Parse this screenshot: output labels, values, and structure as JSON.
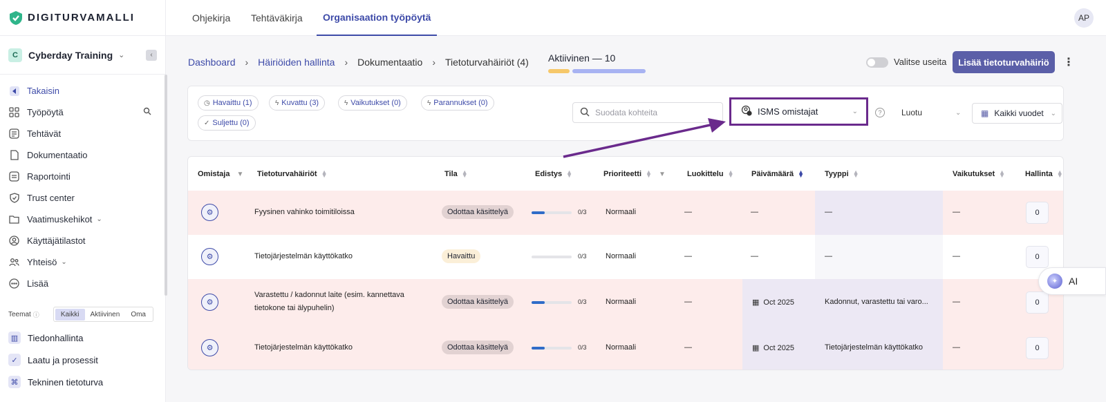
{
  "brand": {
    "name": "DIGITURVAMALLI"
  },
  "org": {
    "badge": "C",
    "name": "Cyberday Training"
  },
  "top_tabs": [
    {
      "label": "Ohjekirja"
    },
    {
      "label": "Tehtäväkirja"
    },
    {
      "label": "Organisaation työpöytä",
      "active": true
    }
  ],
  "avatar": "AP",
  "sidebar": {
    "items": [
      {
        "label": "Takaisin",
        "icon": "back-icon"
      },
      {
        "label": "Työpöytä",
        "icon": "dashboard-icon"
      },
      {
        "label": "Tehtävät",
        "icon": "tasks-icon"
      },
      {
        "label": "Dokumentaatio",
        "icon": "document-icon"
      },
      {
        "label": "Raportointi",
        "icon": "report-icon"
      },
      {
        "label": "Trust center",
        "icon": "shield-icon"
      },
      {
        "label": "Vaatimuskehikot",
        "icon": "folder-icon"
      },
      {
        "label": "Käyttäjätilastot",
        "icon": "user-stats-icon"
      },
      {
        "label": "Yhteisö",
        "icon": "community-icon"
      },
      {
        "label": "Lisää",
        "icon": "more-icon"
      }
    ],
    "themes_label": "Teemat",
    "theme_filters": [
      "Kaikki",
      "Aktiivinen",
      "Oma"
    ],
    "themes": [
      {
        "label": "Tiedonhallinta"
      },
      {
        "label": "Laatu ja prosessit"
      },
      {
        "label": "Tekninen tietoturva"
      }
    ]
  },
  "breadcrumb": {
    "items": [
      "Dashboard",
      "Häiriöiden hallinta",
      "Dokumentaatio",
      "Tietoturvahäiriöt (4)"
    ]
  },
  "active_summary": "Aktiivinen — 10",
  "select_multiple_label": "Valitse useita",
  "add_button_label": "Lisää tietoturvahäiriö",
  "status_chips": [
    "Havaittu (1)",
    "Kuvattu (3)",
    "Vaikutukset (0)",
    "Parannukset (0)",
    "Suljettu (0)"
  ],
  "search": {
    "placeholder": "Suodata kohteita"
  },
  "owner_filter": "ISMS omistajat",
  "created_filter": "Luotu",
  "year_filter": "Kaikki vuodet",
  "table": {
    "columns": [
      "Omistaja",
      "Tietoturvahäiriöt",
      "Tila",
      "Edistys",
      "Prioriteetti",
      "Luokittelu",
      "Päivämäärä",
      "Tyyppi",
      "Vaikutukset",
      "Hallinta"
    ],
    "rows": [
      {
        "title": "Fyysinen vahinko toimitiloissa",
        "title2": "",
        "status": "Odottaa käsittelyä",
        "progress": 0.33,
        "progress_text": "0/3",
        "priority": "Normaali",
        "classification": "—",
        "date": "—",
        "type": "—",
        "impacts": "—",
        "count": "0"
      },
      {
        "title": "Tietojärjestelmän käyttökatko",
        "title2": "",
        "status": "Havaittu",
        "progress": 0,
        "progress_text": "0/3",
        "priority": "Normaali",
        "classification": "—",
        "date": "—",
        "type": "—",
        "impacts": "—",
        "count": "0"
      },
      {
        "title": "Varastettu / kadonnut laite (esim. kannettava",
        "title2": "tietokone tai älypuhelin)",
        "status": "Odottaa käsittelyä",
        "progress": 0.33,
        "progress_text": "0/3",
        "priority": "Normaali",
        "classification": "—",
        "date": "Oct 2025",
        "type": "Kadonnut, varastettu tai varo...",
        "impacts": "—",
        "count": "0"
      },
      {
        "title": "Tietojärjestelmän käyttökatko",
        "title2": "",
        "status": "Odottaa käsittelyä",
        "progress": 0.33,
        "progress_text": "0/3",
        "priority": "Normaali",
        "classification": "—",
        "date": "Oct 2025",
        "type": "Tietojärjestelmän käyttökatko",
        "impacts": "—",
        "count": "0"
      }
    ]
  },
  "ai_button": "AI",
  "colors": {
    "accent": "#3d4aa8",
    "button": "#5b5fa8",
    "annotation": "#6a2a8c",
    "row_pink": "#fdeceb",
    "row_lavender": "#ece8f4"
  }
}
